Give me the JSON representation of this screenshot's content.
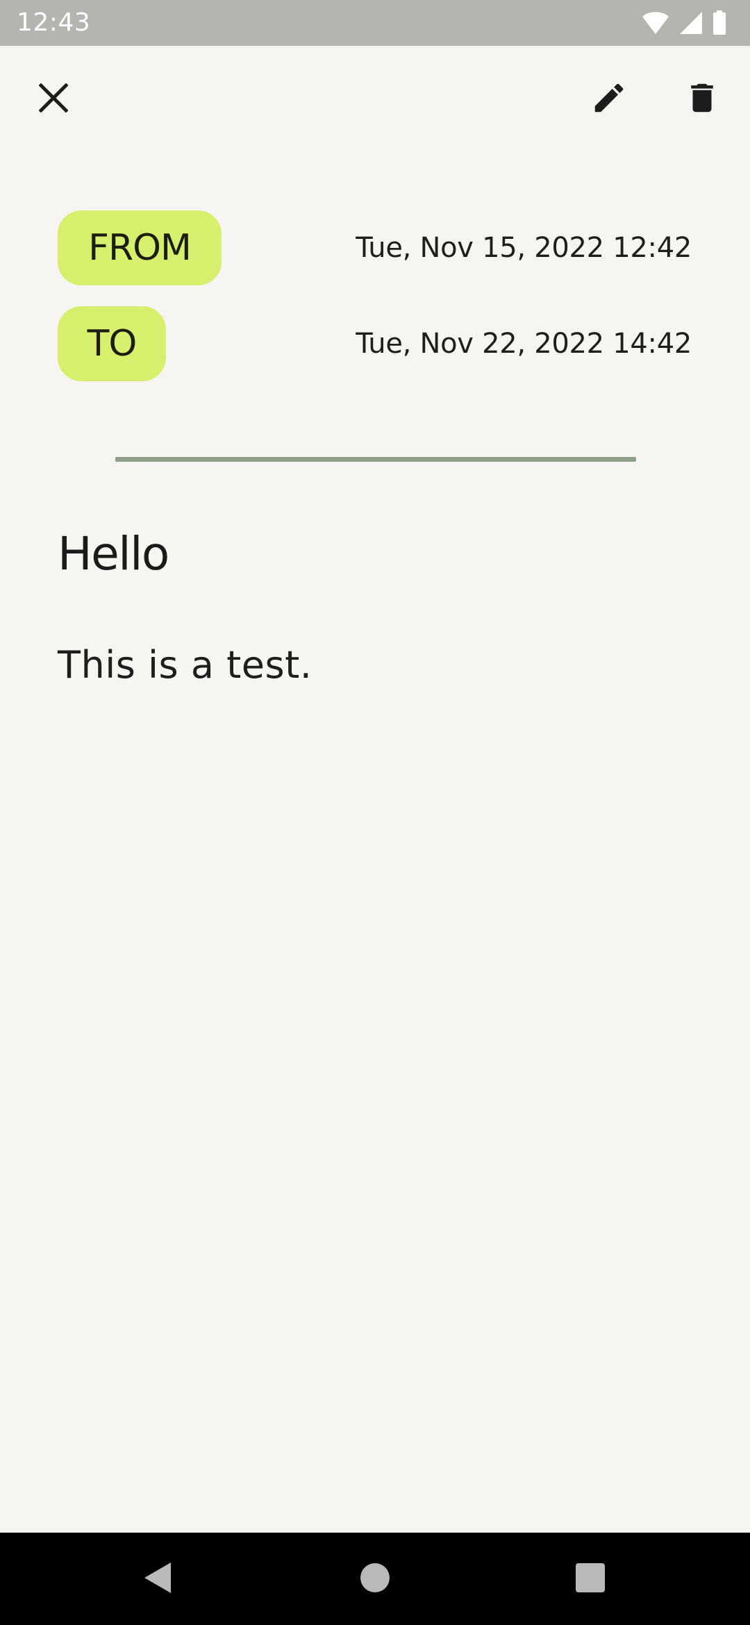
{
  "status_bar": {
    "time": "12:43",
    "icons": [
      "wifi-icon",
      "cellular-signal-icon",
      "battery-icon"
    ],
    "background": "#b5b4b0"
  },
  "toolbar": {
    "close_icon": "close-icon",
    "edit_icon": "pencil-icon",
    "delete_icon": "trash-icon"
  },
  "dates": {
    "from_label": "FROM",
    "from_value": "Tue, Nov 15, 2022 12:42",
    "to_label": "TO",
    "to_value": "Tue, Nov 22, 2022 14:42",
    "chip_color": "#d6f06d"
  },
  "note": {
    "title": "Hello",
    "body": "This is a test."
  },
  "colors": {
    "background": "#f6f5f1",
    "divider": "#909f8c",
    "text": "#1c1c1a"
  },
  "nav_bar": {
    "back_icon": "back-triangle-icon",
    "home_icon": "home-circle-icon",
    "recents_icon": "recents-square-icon"
  }
}
